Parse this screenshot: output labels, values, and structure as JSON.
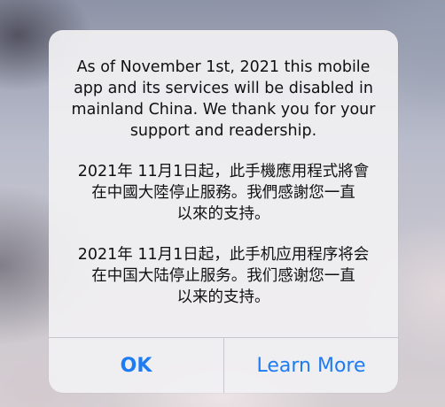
{
  "alert": {
    "message_en": "As of November 1st, 2021 this mobile\napp and its services will be disabled in\nmainland China. We thank you for your\nsupport and readership.",
    "message_zh_hant": "2021年 11月1日起，此手機應用程式將會\n在中國大陸停止服務。我們感謝您一直\n以來的支持。",
    "message_zh_hans": "2021年 11月1日起，此手机应用程序将会\n在中国大陆停止服务。我们感谢您一直\n以来的支持。",
    "ok_label": "OK",
    "learn_more_label": "Learn More"
  },
  "colors": {
    "accent": "#1e7cf2",
    "alert_background": "#f1f0f2",
    "text": "#111111"
  }
}
